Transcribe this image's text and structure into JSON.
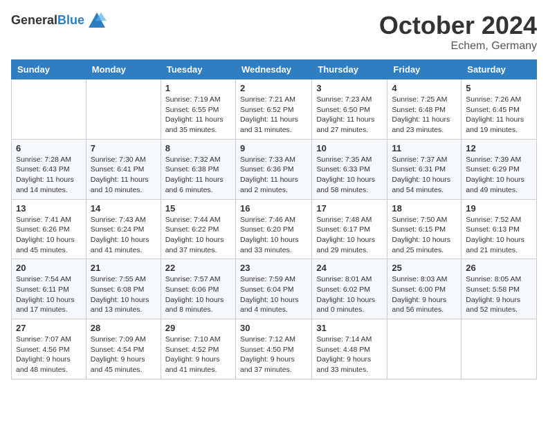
{
  "logo": {
    "general": "General",
    "blue": "Blue"
  },
  "header": {
    "month": "October 2024",
    "location": "Echem, Germany"
  },
  "weekdays": [
    "Sunday",
    "Monday",
    "Tuesday",
    "Wednesday",
    "Thursday",
    "Friday",
    "Saturday"
  ],
  "weeks": [
    [
      {
        "day": "",
        "info": ""
      },
      {
        "day": "",
        "info": ""
      },
      {
        "day": "1",
        "info": "Sunrise: 7:19 AM\nSunset: 6:55 PM\nDaylight: 11 hours and 35 minutes."
      },
      {
        "day": "2",
        "info": "Sunrise: 7:21 AM\nSunset: 6:52 PM\nDaylight: 11 hours and 31 minutes."
      },
      {
        "day": "3",
        "info": "Sunrise: 7:23 AM\nSunset: 6:50 PM\nDaylight: 11 hours and 27 minutes."
      },
      {
        "day": "4",
        "info": "Sunrise: 7:25 AM\nSunset: 6:48 PM\nDaylight: 11 hours and 23 minutes."
      },
      {
        "day": "5",
        "info": "Sunrise: 7:26 AM\nSunset: 6:45 PM\nDaylight: 11 hours and 19 minutes."
      }
    ],
    [
      {
        "day": "6",
        "info": "Sunrise: 7:28 AM\nSunset: 6:43 PM\nDaylight: 11 hours and 14 minutes."
      },
      {
        "day": "7",
        "info": "Sunrise: 7:30 AM\nSunset: 6:41 PM\nDaylight: 11 hours and 10 minutes."
      },
      {
        "day": "8",
        "info": "Sunrise: 7:32 AM\nSunset: 6:38 PM\nDaylight: 11 hours and 6 minutes."
      },
      {
        "day": "9",
        "info": "Sunrise: 7:33 AM\nSunset: 6:36 PM\nDaylight: 11 hours and 2 minutes."
      },
      {
        "day": "10",
        "info": "Sunrise: 7:35 AM\nSunset: 6:33 PM\nDaylight: 10 hours and 58 minutes."
      },
      {
        "day": "11",
        "info": "Sunrise: 7:37 AM\nSunset: 6:31 PM\nDaylight: 10 hours and 54 minutes."
      },
      {
        "day": "12",
        "info": "Sunrise: 7:39 AM\nSunset: 6:29 PM\nDaylight: 10 hours and 49 minutes."
      }
    ],
    [
      {
        "day": "13",
        "info": "Sunrise: 7:41 AM\nSunset: 6:26 PM\nDaylight: 10 hours and 45 minutes."
      },
      {
        "day": "14",
        "info": "Sunrise: 7:43 AM\nSunset: 6:24 PM\nDaylight: 10 hours and 41 minutes."
      },
      {
        "day": "15",
        "info": "Sunrise: 7:44 AM\nSunset: 6:22 PM\nDaylight: 10 hours and 37 minutes."
      },
      {
        "day": "16",
        "info": "Sunrise: 7:46 AM\nSunset: 6:20 PM\nDaylight: 10 hours and 33 minutes."
      },
      {
        "day": "17",
        "info": "Sunrise: 7:48 AM\nSunset: 6:17 PM\nDaylight: 10 hours and 29 minutes."
      },
      {
        "day": "18",
        "info": "Sunrise: 7:50 AM\nSunset: 6:15 PM\nDaylight: 10 hours and 25 minutes."
      },
      {
        "day": "19",
        "info": "Sunrise: 7:52 AM\nSunset: 6:13 PM\nDaylight: 10 hours and 21 minutes."
      }
    ],
    [
      {
        "day": "20",
        "info": "Sunrise: 7:54 AM\nSunset: 6:11 PM\nDaylight: 10 hours and 17 minutes."
      },
      {
        "day": "21",
        "info": "Sunrise: 7:55 AM\nSunset: 6:08 PM\nDaylight: 10 hours and 13 minutes."
      },
      {
        "day": "22",
        "info": "Sunrise: 7:57 AM\nSunset: 6:06 PM\nDaylight: 10 hours and 8 minutes."
      },
      {
        "day": "23",
        "info": "Sunrise: 7:59 AM\nSunset: 6:04 PM\nDaylight: 10 hours and 4 minutes."
      },
      {
        "day": "24",
        "info": "Sunrise: 8:01 AM\nSunset: 6:02 PM\nDaylight: 10 hours and 0 minutes."
      },
      {
        "day": "25",
        "info": "Sunrise: 8:03 AM\nSunset: 6:00 PM\nDaylight: 9 hours and 56 minutes."
      },
      {
        "day": "26",
        "info": "Sunrise: 8:05 AM\nSunset: 5:58 PM\nDaylight: 9 hours and 52 minutes."
      }
    ],
    [
      {
        "day": "27",
        "info": "Sunrise: 7:07 AM\nSunset: 4:56 PM\nDaylight: 9 hours and 48 minutes."
      },
      {
        "day": "28",
        "info": "Sunrise: 7:09 AM\nSunset: 4:54 PM\nDaylight: 9 hours and 45 minutes."
      },
      {
        "day": "29",
        "info": "Sunrise: 7:10 AM\nSunset: 4:52 PM\nDaylight: 9 hours and 41 minutes."
      },
      {
        "day": "30",
        "info": "Sunrise: 7:12 AM\nSunset: 4:50 PM\nDaylight: 9 hours and 37 minutes."
      },
      {
        "day": "31",
        "info": "Sunrise: 7:14 AM\nSunset: 4:48 PM\nDaylight: 9 hours and 33 minutes."
      },
      {
        "day": "",
        "info": ""
      },
      {
        "day": "",
        "info": ""
      }
    ]
  ]
}
